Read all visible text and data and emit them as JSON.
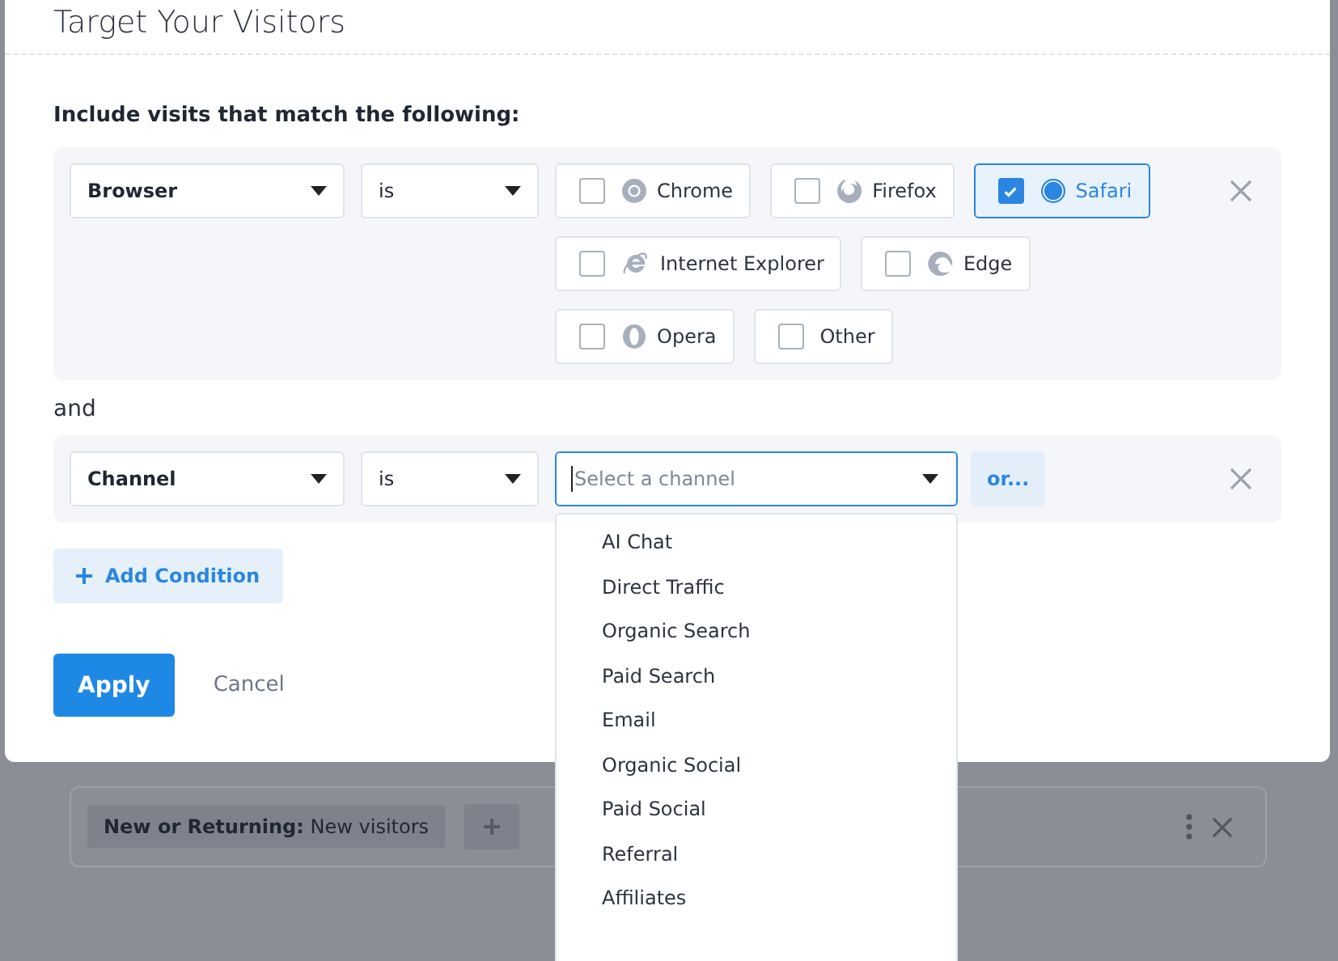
{
  "modal": {
    "title": "Target Your Visitors",
    "intro": "Include visits that match the following:",
    "conditions": [
      {
        "kind": "checkboxes",
        "field": "Browser",
        "operator": "is",
        "options": [
          {
            "label": "Chrome",
            "kind": "chrome",
            "checked": false
          },
          {
            "label": "Firefox",
            "kind": "firefox",
            "checked": false
          },
          {
            "label": "Safari",
            "kind": "safari",
            "checked": true
          },
          {
            "label": "Internet Explorer",
            "kind": "ie",
            "checked": false
          },
          {
            "label": "Edge",
            "kind": "edge",
            "checked": false
          },
          {
            "label": "Opera",
            "kind": "opera",
            "checked": false
          },
          {
            "label": "Other",
            "kind": "plain",
            "checked": false
          }
        ]
      },
      {
        "kind": "select",
        "field": "Channel",
        "operator": "is",
        "placeholder": "Select a channel",
        "focused": true,
        "or_button": "or...",
        "dropdown": {
          "open": true,
          "items": [
            "AI Chat",
            "Direct Traffic",
            "Organic Search",
            "Paid Search",
            "Email",
            "Organic Social",
            "Paid Social",
            "Referral",
            "Affiliates"
          ]
        }
      }
    ],
    "joiner": "and",
    "add_condition": "Add Condition",
    "apply": "Apply",
    "cancel": "Cancel"
  },
  "background": {
    "segment_chip": {
      "label": "New or Returning:",
      "value": "New visitors"
    }
  }
}
